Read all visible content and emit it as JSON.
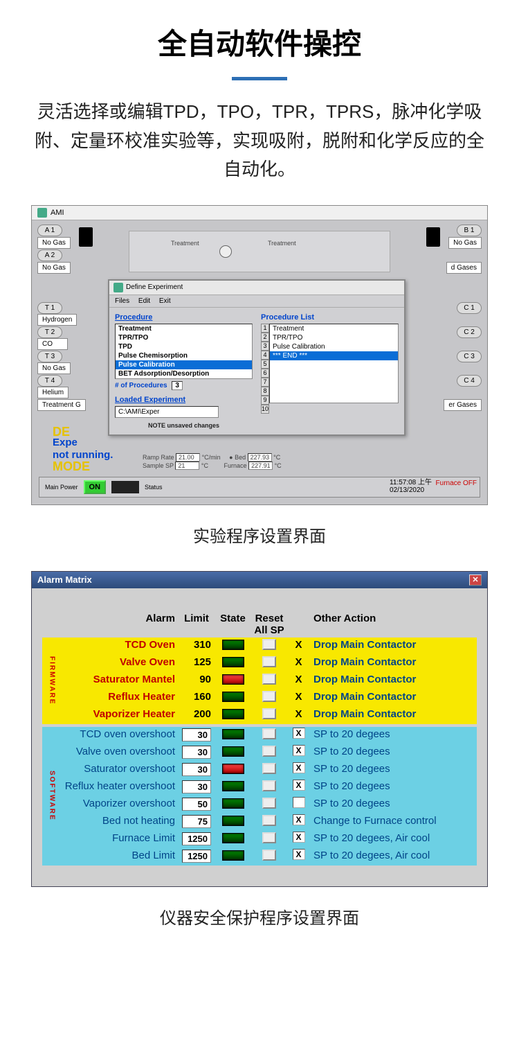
{
  "page": {
    "title": "全自动软件操控",
    "description": "灵活选择或编辑TPD，TPO，TPR，TPRS，脉冲化学吸附、定量环校准实验等，实现吸附，脱附和化学反应的全自动化。",
    "caption1": "实验程序设置界面",
    "caption2": "仪器安全保护程序设置界面"
  },
  "ami": {
    "window_title": "AMI",
    "gas_boxes": {
      "a1": "A 1",
      "a1_val": "No Gas",
      "a2": "A 2",
      "a2_val": "No Gas",
      "b1": "B 1",
      "b1_val": "No Gas",
      "b2": "",
      "b2_label": "d Gases",
      "t1": "T 1",
      "t1_val": "Hydrogen",
      "t2": "T 2",
      "t2_val": "CO",
      "t3": "T 3",
      "t3_val": "No Gas",
      "t4": "T 4",
      "t4_val": "Helium",
      "treatment": "Treatment G",
      "c1": "C 1",
      "c2": "C 2",
      "c3": "C 3",
      "c4": "C 4",
      "right_labels": [
        "es",
        "es"
      ],
      "er_gases": "er Gases"
    },
    "schematic": {
      "label1": "Treatment",
      "label2": "Treatment"
    },
    "dialog": {
      "title": "Define Experiment",
      "menu": [
        "Files",
        "Edit",
        "Exit"
      ],
      "procedure_hdr": "Procedure",
      "procedure_list_hdr": "Procedure List",
      "procedures": [
        "Treatment",
        "TPR/TPO",
        "TPD",
        "Pulse Chemisorption",
        "Pulse Calibration",
        "BET Adsorption/Desorption"
      ],
      "procedure_selected_idx": 4,
      "list_items": [
        "Treatment",
        "TPR/TPO",
        "Pulse Calibration",
        "*** END ***"
      ],
      "list_selected_idx": 3,
      "list_numbers": [
        1,
        2,
        3,
        4,
        5,
        6,
        7,
        8,
        9,
        10
      ],
      "proc_count_label": "# of Procedures",
      "proc_count": "3",
      "loaded_hdr": "Loaded Experiment",
      "loaded_path": "C:\\AMI\\Exper",
      "note": "NOTE unsaved changes"
    },
    "demo": {
      "de": "DE",
      "expe": "Expe",
      "not_running": "not running.",
      "mode": "MODE"
    },
    "params": {
      "ramp_rate_lbl": "Ramp Rate",
      "ramp_rate": "21.00",
      "ramp_unit": "°C/min",
      "sample_sp_lbl": "Sample SP",
      "sample_sp": "21",
      "sample_unit": "°C",
      "bed_lbl": "Bed",
      "bed_val": "227.93",
      "bed_unit": "°C",
      "furnace_lbl": "Furnace",
      "furnace_val": "227.91",
      "furnace_unit": "°C"
    },
    "status": {
      "main_power_lbl": "Main Power",
      "on": "ON",
      "status_lbl": "Status",
      "time": "11:57:08 上午",
      "date": "02/13/2020",
      "furnace_off": "Furnace OFF"
    }
  },
  "alarm": {
    "window_title": "Alarm Matrix",
    "headers": {
      "alarm": "Alarm",
      "limit": "Limit",
      "state": "State",
      "reset_top": "Reset",
      "reset": "All SP",
      "other": "Other Action"
    },
    "firmware_label": "FIRMWARE",
    "software_label": "SOFTWARE",
    "firmware_rows": [
      {
        "name": "TCD Oven",
        "limit": "310",
        "state": "green",
        "x": "X",
        "action": "Drop Main Contactor"
      },
      {
        "name": "Valve Oven",
        "limit": "125",
        "state": "green",
        "x": "X",
        "action": "Drop Main Contactor"
      },
      {
        "name": "Saturator Mantel",
        "limit": "90",
        "state": "red",
        "x": "X",
        "action": "Drop Main Contactor"
      },
      {
        "name": "Reflux Heater",
        "limit": "160",
        "state": "green",
        "x": "X",
        "action": "Drop Main Contactor"
      },
      {
        "name": "Vaporizer Heater",
        "limit": "200",
        "state": "green",
        "x": "X",
        "action": "Drop Main Contactor"
      }
    ],
    "software_rows": [
      {
        "name": "TCD oven overshoot",
        "limit": "30",
        "state": "green",
        "x": "X",
        "action": "SP to 20 degees"
      },
      {
        "name": "Valve oven overshoot",
        "limit": "30",
        "state": "green",
        "x": "X",
        "action": "SP to 20 degees"
      },
      {
        "name": "Saturator overshoot",
        "limit": "30",
        "state": "red",
        "x": "X",
        "action": "SP to 20 degees"
      },
      {
        "name": "Reflux heater overshoot",
        "limit": "30",
        "state": "green",
        "x": "X",
        "action": "SP to 20 degees"
      },
      {
        "name": "Vaporizer overshoot",
        "limit": "50",
        "state": "green",
        "x": "",
        "action": "SP to 20 degees"
      },
      {
        "name": "Bed not heating",
        "limit": "75",
        "state": "green",
        "x": "X",
        "action": "Change to Furnace control"
      },
      {
        "name": "Furnace Limit",
        "limit": "1250",
        "state": "green",
        "x": "X",
        "action": "SP to 20 degees, Air cool"
      },
      {
        "name": "Bed Limit",
        "limit": "1250",
        "state": "green",
        "x": "X",
        "action": "SP to 20 degees, Air cool"
      }
    ]
  }
}
